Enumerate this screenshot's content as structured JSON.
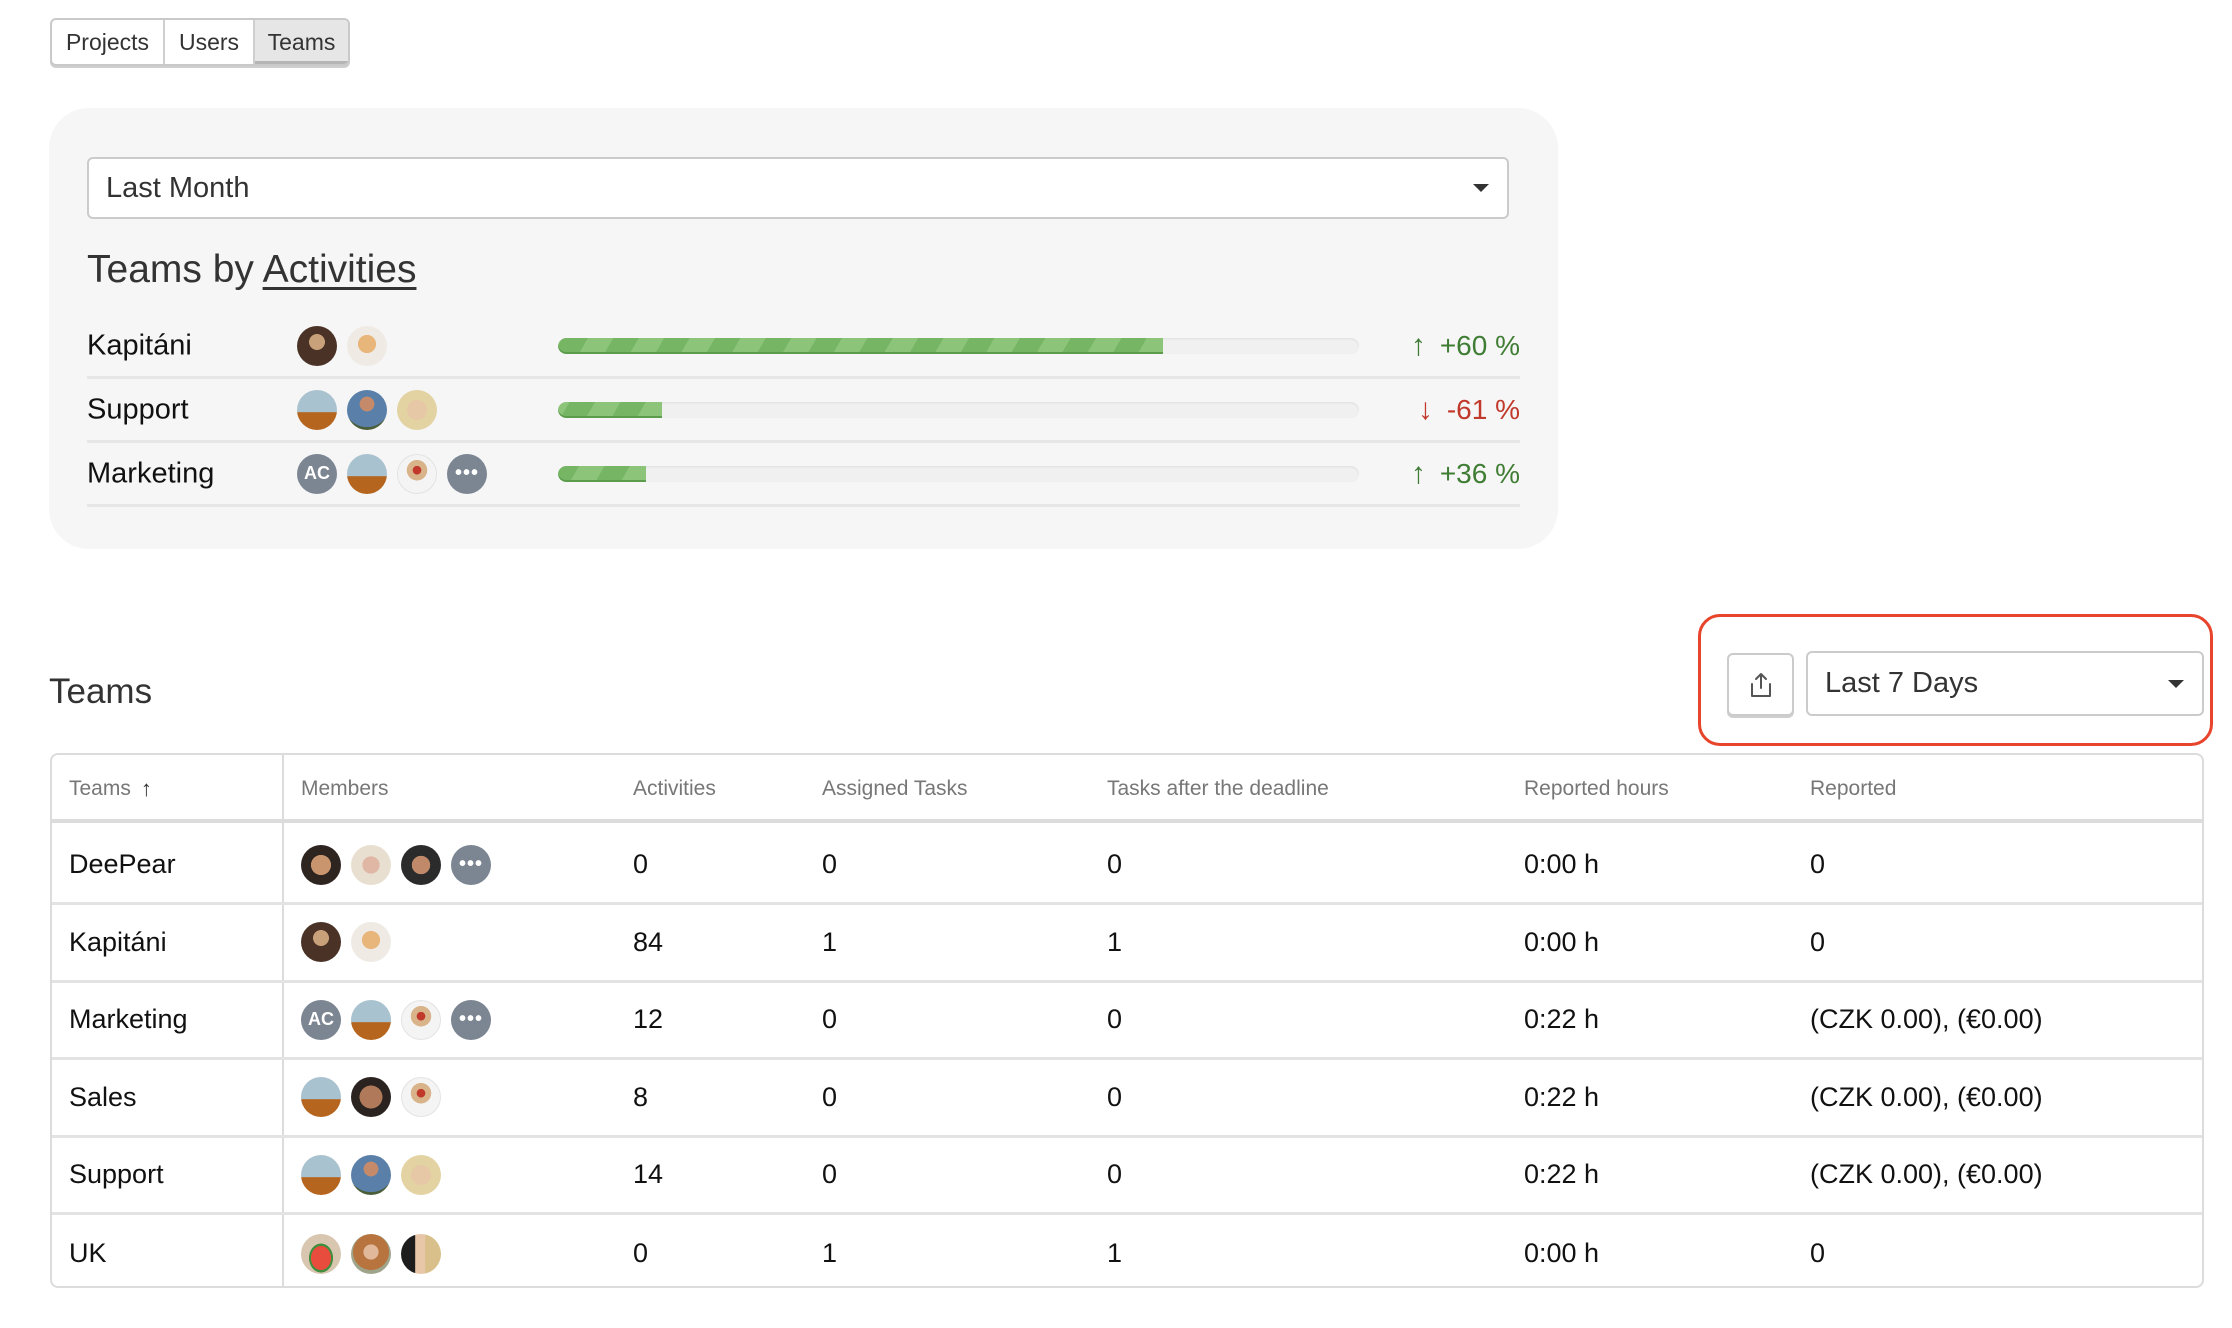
{
  "tabs": [
    {
      "label": "Projects",
      "active": false
    },
    {
      "label": "Users",
      "active": false
    },
    {
      "label": "Teams",
      "active": true
    }
  ],
  "activity_panel": {
    "period_select": {
      "value": "Last Month"
    },
    "title_prefix": "Teams by",
    "title_link": "Activities",
    "rows": [
      {
        "team": "Kapitáni",
        "avatars": [
          "photo-dark",
          "photo-cat"
        ],
        "progress_fraction": 0.755,
        "delta": "+60 %",
        "direction": "up"
      },
      {
        "team": "Support",
        "avatars": [
          "photo-flower",
          "photo-denim",
          "photo-blonde"
        ],
        "progress_fraction": 0.13,
        "delta": "-61 %",
        "direction": "down"
      },
      {
        "team": "Marketing",
        "avatars": [
          "initials:AC",
          "photo-flower",
          "photo-cupcake",
          "more"
        ],
        "progress_fraction": 0.11,
        "delta": "+36 %",
        "direction": "up"
      }
    ],
    "arrow_up": "↑",
    "arrow_down": "↓",
    "colors": {
      "up": "#3f7d34",
      "down": "#c0392b",
      "bar": "#76b564"
    }
  },
  "teams_section": {
    "title": "Teams",
    "export_icon": "share-export-icon",
    "period_select": {
      "value": "Last 7 Days"
    },
    "highlight_color": "#e8442b"
  },
  "table": {
    "columns": [
      "Teams",
      "Members",
      "Activities",
      "Assigned Tasks",
      "Tasks after the deadline",
      "Reported hours",
      "Reported"
    ],
    "sort_indicator": "↑",
    "rows": [
      {
        "team": "DeePear",
        "members": [
          "photo-beard",
          "photo-blonde2",
          "photo-man",
          "more"
        ],
        "activities": "0",
        "assigned": "0",
        "after_deadline": "0",
        "hours": "0:00 h",
        "reported": "0"
      },
      {
        "team": "Kapitáni",
        "members": [
          "photo-dark",
          "photo-cat"
        ],
        "activities": "84",
        "assigned": "1",
        "after_deadline": "1",
        "hours": "0:00 h",
        "reported": "0"
      },
      {
        "team": "Marketing",
        "members": [
          "initials:AC",
          "photo-flower",
          "photo-cupcake",
          "more"
        ],
        "activities": "12",
        "assigned": "0",
        "after_deadline": "0",
        "hours": "0:22 h",
        "reported": "(CZK 0.00), (€0.00)"
      },
      {
        "team": "Sales",
        "members": [
          "photo-flower",
          "photo-smile",
          "photo-cupcake"
        ],
        "activities": "8",
        "assigned": "0",
        "after_deadline": "0",
        "hours": "0:22 h",
        "reported": "(CZK 0.00), (€0.00)"
      },
      {
        "team": "Support",
        "members": [
          "photo-flower",
          "photo-denim",
          "photo-blonde"
        ],
        "activities": "14",
        "assigned": "0",
        "after_deadline": "0",
        "hours": "0:22 h",
        "reported": "(CZK 0.00), (€0.00)"
      },
      {
        "team": "UK",
        "members": [
          "photo-melon",
          "photo-redhair",
          "photo-side"
        ],
        "activities": "0",
        "assigned": "1",
        "after_deadline": "1",
        "hours": "0:00 h",
        "reported": "0"
      }
    ]
  }
}
